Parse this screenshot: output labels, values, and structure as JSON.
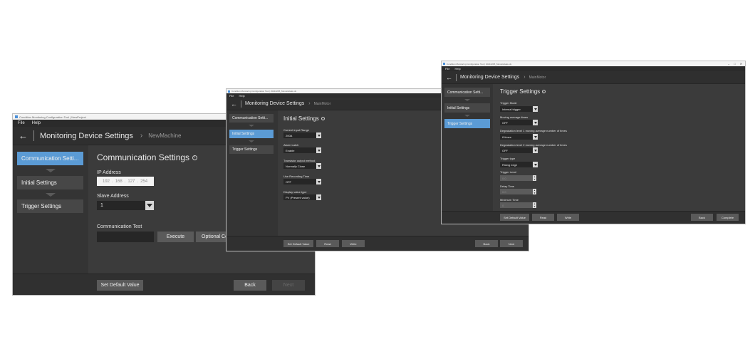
{
  "app_title": "Condition Monitoring Configuration Tool",
  "window1_title": "Condition Monitoring Configuration Tool | NewProject",
  "window2_title": "Condition Monitoring Configuration Tool | 20210205_Monoitubaku.ds",
  "window3_title": "Condition Monitoring Configuration Tool | 20210205_Monoitubaku.ds",
  "menu": {
    "file": "File",
    "help": "Help"
  },
  "header": {
    "title": "Monitoring Device Settings",
    "machine1": "NewMachine",
    "machine2": "MainMotor"
  },
  "steps": {
    "communication": "Communication Setti...",
    "initial": "Initial Settings",
    "trigger": "Trigger Settings"
  },
  "comm": {
    "title": "Communication Settings",
    "ip_label": "IP Address",
    "ip": [
      "192",
      "168",
      "127",
      "254"
    ],
    "slave_label": "Slave Address",
    "slave_value": "1",
    "test_label": "Communication Test",
    "execute": "Execute",
    "optional": "Optional Co"
  },
  "initial": {
    "title": "Initial Settings",
    "current_range_label": "Current input Range",
    "current_range_value": "200A",
    "alarm_latch_label": "Alarm Latch",
    "alarm_latch_value": "Enable",
    "transistor_label": "Transistor output method",
    "transistor_value": "Normally Close",
    "recording_label": "Use Recording Time",
    "recording_value": "OFF",
    "display_label": "Display value type",
    "display_value": "PV (Present value)"
  },
  "trigger": {
    "title": "Trigger Settings",
    "mode_label": "Trigger Mode",
    "mode_value": "Internal trigger",
    "moving_label": "Moving average times",
    "moving_value": "OFF",
    "deg1_label": "Degradation level 1 moving average number of times",
    "deg1_value": "8 times",
    "deg2_label": "Degradation level 2 moving average number of times",
    "deg2_value": "OFF",
    "type_label": "Trigger type",
    "type_value": "Rising edge",
    "level_label": "Trigger Level",
    "level_value": "0.0",
    "delay_label": "Delay Time",
    "delay_value": "0.0",
    "minimum_label": "Minimum Time",
    "minimum_value": "0"
  },
  "buttons": {
    "set_default": "Set Default Value",
    "read": "Read",
    "write": "Write",
    "back": "Back",
    "next": "Next",
    "complete": "Complete"
  },
  "colors": {
    "background": "#3b3b3b",
    "active_step": "#5b9bd5",
    "button": "#5a5a5a"
  }
}
